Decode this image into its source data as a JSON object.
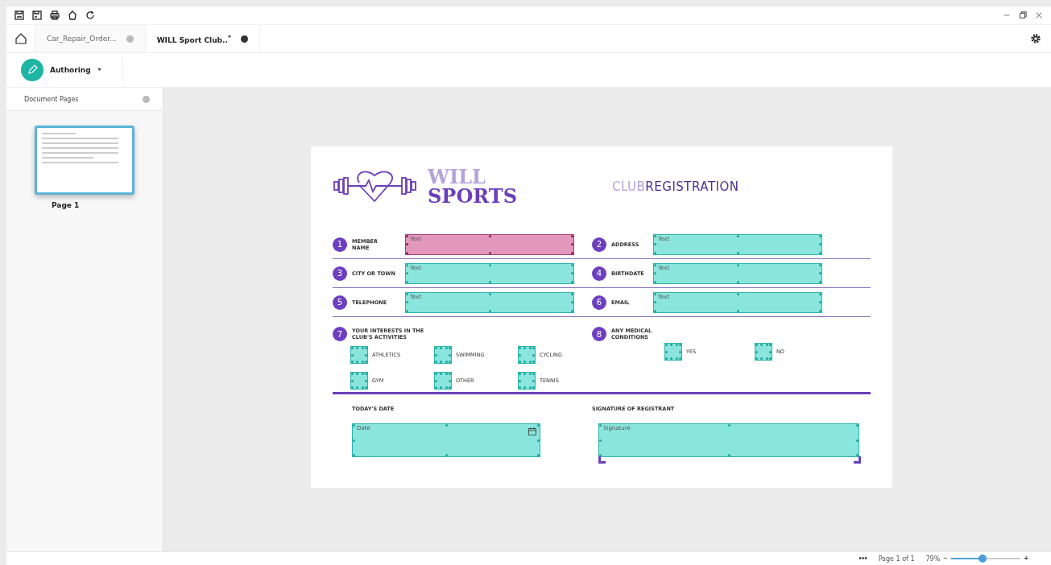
{
  "tabs": [
    {
      "label": "Car_Repair_Order...",
      "selected": false
    },
    {
      "label": "WILL Sport Club..$^{*}$",
      "selected": true
    }
  ],
  "mode": {
    "label": "Authoring"
  },
  "pages_panel": {
    "title": "Document Pages",
    "pages": [
      {
        "label": "Page 1",
        "selected": true
      }
    ]
  },
  "form": {
    "logo": {
      "line1": "WILL",
      "line2": "SPORTS"
    },
    "title": {
      "light": "CLUB",
      "bold": "REGISTRATION"
    },
    "rows": [
      [
        {
          "number": "1",
          "label": "MEMBER NAME",
          "placeholder": "Text",
          "selected": true
        },
        {
          "number": "2",
          "label": "ADDRESS",
          "placeholder": "Text",
          "selected": false
        }
      ],
      [
        {
          "number": "3",
          "label": "CITY OR TOWN",
          "placeholder": "Text",
          "selected": false
        },
        {
          "number": "4",
          "label": "BIRTHDATE",
          "placeholder": "Text",
          "selected": false
        }
      ],
      [
        {
          "number": "5",
          "label": "TELEPHONE",
          "placeholder": "Text",
          "selected": false
        },
        {
          "number": "6",
          "label": "EMAIL",
          "placeholder": "Text",
          "selected": false
        }
      ]
    ],
    "interests": {
      "number": "7",
      "label": "YOUR INTERESTS IN THE CLUB'S ACTIVITIES",
      "options": [
        "ATHLETICS",
        "SWIMMING",
        "CYCLING",
        "GYM",
        "OTHER",
        "TENNIS"
      ]
    },
    "medical": {
      "number": "8",
      "label": "ANY MEDICAL CONDITIONS",
      "options": [
        "YES",
        "NO"
      ]
    },
    "date": {
      "label": "TODAY'S DATE",
      "placeholder": "Date"
    },
    "signature": {
      "label": "SIGNATURE OF REGISTRANT",
      "placeholder": "Signature"
    }
  },
  "status_bar": {
    "more": "•••",
    "page": "Page 1 of 1",
    "zoom": "79%",
    "zoom_slider": {
      "level": 0.45
    },
    "minus": "−",
    "plus": "+"
  }
}
